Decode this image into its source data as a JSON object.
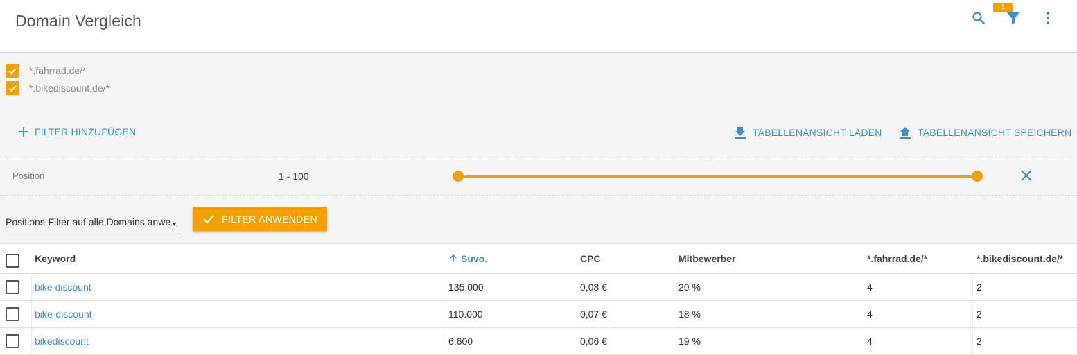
{
  "header": {
    "title": "Domain Vergleich",
    "filter_badge": "1",
    "icons": [
      "search-icon",
      "filter-icon",
      "more-vert-icon"
    ]
  },
  "domains": [
    {
      "label": "*.fahrrad.de/*",
      "checked": true
    },
    {
      "label": "*.bikediscount.de/*",
      "checked": true
    }
  ],
  "actions": {
    "add_filter": "FILTER HINZUFÜGEN",
    "load_view": "TABELLENANSICHT LADEN",
    "save_view": "TABELLENANSICHT SPEICHERN"
  },
  "position_filter": {
    "label": "Position",
    "range_text": "1 - 100",
    "min": 1,
    "max": 100
  },
  "apply": {
    "select_value": "Positions-Filter auf alle Domains anwe",
    "button_label": "FILTER ANWENDEN"
  },
  "table": {
    "columns": [
      "Keyword",
      "Suvo.",
      "CPC",
      "Mitbewerber",
      "*.fahrrad.de/*",
      "*.bikediscount.de/*"
    ],
    "sort_column": "Suvo.",
    "rows": [
      {
        "keyword": "bike discount",
        "suvo": "135.000",
        "cpc": "0,08 €",
        "mitbewerber": "20 %",
        "fahrrad": "4",
        "bikediscount": "2"
      },
      {
        "keyword": "bike-discount",
        "suvo": "110.000",
        "cpc": "0,07 €",
        "mitbewerber": "18 %",
        "fahrrad": "4",
        "bikediscount": "2"
      },
      {
        "keyword": "bikediscount",
        "suvo": "6.600",
        "cpc": "0,06 €",
        "mitbewerber": "19 %",
        "fahrrad": "4",
        "bikediscount": "2"
      }
    ]
  },
  "colors": {
    "accent": "#f5a000",
    "link": "#3a8fd0"
  }
}
